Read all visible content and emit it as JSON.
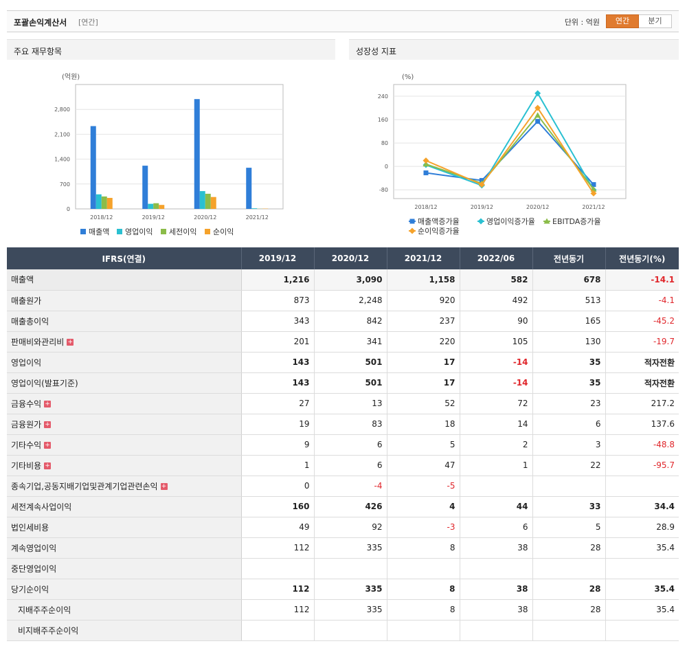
{
  "header": {
    "title": "포괄손익계산서",
    "sub": "[연간]",
    "unit": "단위 : 억원",
    "seg_annual": "연간",
    "seg_quarter": "분기"
  },
  "left_panel_title": "주요 재무항목",
  "right_panel_title": "성장성 지표",
  "chart_data": [
    {
      "type": "bar",
      "ylabel": "(억원)",
      "categories": [
        "2018/12",
        "2019/12",
        "2020/12",
        "2021/12"
      ],
      "ylim": [
        0,
        3500
      ],
      "yticks": [
        0,
        700,
        1400,
        2100,
        2800
      ],
      "ytick_labels": [
        "0",
        "700",
        "1,400",
        "2,100",
        "2,800"
      ],
      "grid": true,
      "legend": "bottom",
      "series": [
        {
          "name": "매출액",
          "color": "#2f7ed8",
          "values": [
            2330,
            1216,
            3090,
            1158
          ]
        },
        {
          "name": "영업이익",
          "color": "#2ac0d1",
          "values": [
            410,
            143,
            501,
            17
          ]
        },
        {
          "name": "세전이익",
          "color": "#8bbc49",
          "values": [
            350,
            160,
            426,
            4
          ]
        },
        {
          "name": "순이익",
          "color": "#f5a22b",
          "values": [
            310,
            112,
            335,
            8
          ]
        }
      ]
    },
    {
      "type": "line",
      "ylabel": "(%)",
      "categories": [
        "2018/12",
        "2019/12",
        "2020/12",
        "2021/12"
      ],
      "ylim": [
        -110,
        280
      ],
      "yticks": [
        -80,
        0,
        80,
        160,
        240
      ],
      "ytick_labels": [
        "-80",
        "0",
        "80",
        "160",
        "240"
      ],
      "grid": true,
      "legend": "bottom",
      "series": [
        {
          "name": "매출액증가율",
          "color": "#2f7ed8",
          "marker": "square",
          "values": [
            -22,
            -48,
            154,
            -62
          ]
        },
        {
          "name": "영업이익증가율",
          "color": "#2ac0d1",
          "marker": "diamond",
          "values": [
            5,
            -65,
            250,
            -80
          ]
        },
        {
          "name": "EBITDA증가율",
          "color": "#8bbc49",
          "marker": "triangle",
          "values": [
            8,
            -58,
            175,
            -78
          ]
        },
        {
          "name": "순이익증가율",
          "color": "#f5a22b",
          "marker": "diamond",
          "values": [
            20,
            -62,
            200,
            -92
          ]
        }
      ]
    }
  ],
  "table": {
    "headers": [
      "IFRS(연결)",
      "2019/12",
      "2020/12",
      "2021/12",
      "2022/06",
      "전년동기",
      "전년동기(%)"
    ],
    "rows": [
      {
        "label": "매출액",
        "bold": true,
        "plus": false,
        "values": [
          "1,216",
          "3,090",
          "1,158",
          "582",
          "678",
          "-14.1"
        ],
        "neg": [
          false,
          false,
          false,
          false,
          false,
          true
        ]
      },
      {
        "label": "매출원가",
        "bold": false,
        "plus": false,
        "values": [
          "873",
          "2,248",
          "920",
          "492",
          "513",
          "-4.1"
        ],
        "neg": [
          false,
          false,
          false,
          false,
          false,
          true
        ]
      },
      {
        "label": "매출총이익",
        "bold": false,
        "plus": false,
        "values": [
          "343",
          "842",
          "237",
          "90",
          "165",
          "-45.2"
        ],
        "neg": [
          false,
          false,
          false,
          false,
          false,
          true
        ]
      },
      {
        "label": "판매비와관리비",
        "bold": false,
        "plus": true,
        "values": [
          "201",
          "341",
          "220",
          "105",
          "130",
          "-19.7"
        ],
        "neg": [
          false,
          false,
          false,
          false,
          false,
          true
        ]
      },
      {
        "label": "영업이익",
        "bold": true,
        "plus": false,
        "values": [
          "143",
          "501",
          "17",
          "-14",
          "35",
          "적자전환"
        ],
        "neg": [
          false,
          false,
          false,
          true,
          false,
          false
        ]
      },
      {
        "label": "영업이익(발표기준)",
        "bold": true,
        "plus": false,
        "values": [
          "143",
          "501",
          "17",
          "-14",
          "35",
          "적자전환"
        ],
        "neg": [
          false,
          false,
          false,
          true,
          false,
          false
        ]
      },
      {
        "label": "금융수익",
        "bold": false,
        "plus": true,
        "values": [
          "27",
          "13",
          "52",
          "72",
          "23",
          "217.2"
        ],
        "neg": [
          false,
          false,
          false,
          false,
          false,
          false
        ]
      },
      {
        "label": "금융원가",
        "bold": false,
        "plus": true,
        "values": [
          "19",
          "83",
          "18",
          "14",
          "6",
          "137.6"
        ],
        "neg": [
          false,
          false,
          false,
          false,
          false,
          false
        ]
      },
      {
        "label": "기타수익",
        "bold": false,
        "plus": true,
        "values": [
          "9",
          "6",
          "5",
          "2",
          "3",
          "-48.8"
        ],
        "neg": [
          false,
          false,
          false,
          false,
          false,
          true
        ]
      },
      {
        "label": "기타비용",
        "bold": false,
        "plus": true,
        "values": [
          "1",
          "6",
          "47",
          "1",
          "22",
          "-95.7"
        ],
        "neg": [
          false,
          false,
          false,
          false,
          false,
          true
        ]
      },
      {
        "label": "종속기업,공동지배기업및관계기업관련손익",
        "bold": false,
        "plus": true,
        "values": [
          "0",
          "-4",
          "-5",
          "",
          "",
          ""
        ],
        "neg": [
          false,
          true,
          true,
          false,
          false,
          false
        ]
      },
      {
        "label": "세전계속사업이익",
        "bold": true,
        "plus": false,
        "values": [
          "160",
          "426",
          "4",
          "44",
          "33",
          "34.4"
        ],
        "neg": [
          false,
          false,
          false,
          false,
          false,
          false
        ]
      },
      {
        "label": "법인세비용",
        "bold": false,
        "plus": false,
        "values": [
          "49",
          "92",
          "-3",
          "6",
          "5",
          "28.9"
        ],
        "neg": [
          false,
          false,
          true,
          false,
          false,
          false
        ]
      },
      {
        "label": "계속영업이익",
        "bold": false,
        "plus": false,
        "values": [
          "112",
          "335",
          "8",
          "38",
          "28",
          "35.4"
        ],
        "neg": [
          false,
          false,
          false,
          false,
          false,
          false
        ]
      },
      {
        "label": "중단영업이익",
        "bold": false,
        "plus": false,
        "values": [
          "",
          "",
          "",
          "",
          "",
          ""
        ],
        "neg": [
          false,
          false,
          false,
          false,
          false,
          false
        ]
      },
      {
        "label": "당기순이익",
        "bold": true,
        "plus": false,
        "values": [
          "112",
          "335",
          "8",
          "38",
          "28",
          "35.4"
        ],
        "neg": [
          false,
          false,
          false,
          false,
          false,
          false
        ]
      },
      {
        "label": "지배주주순이익",
        "bold": false,
        "plus": false,
        "indent": true,
        "values": [
          "112",
          "335",
          "8",
          "38",
          "28",
          "35.4"
        ],
        "neg": [
          false,
          false,
          false,
          false,
          false,
          false
        ]
      },
      {
        "label": "비지배주주순이익",
        "bold": false,
        "plus": false,
        "indent": true,
        "values": [
          "",
          "",
          "",
          "",
          "",
          ""
        ],
        "neg": [
          false,
          false,
          false,
          false,
          false,
          false
        ]
      }
    ]
  }
}
